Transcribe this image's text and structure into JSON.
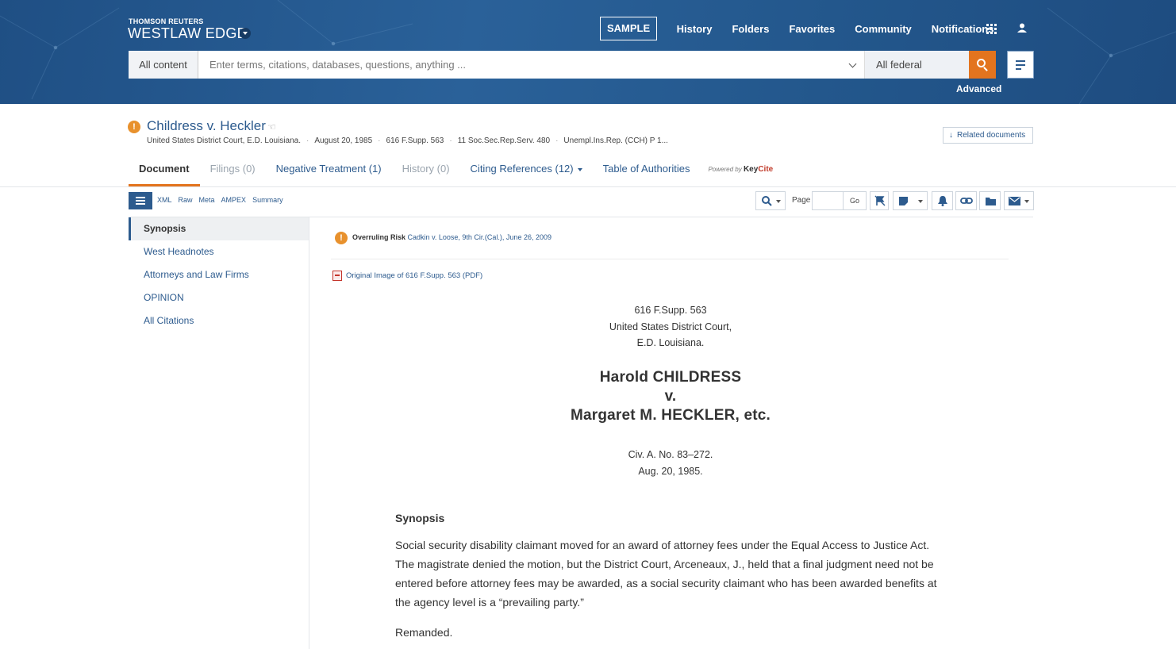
{
  "header": {
    "brand_small": "THOMSON REUTERS",
    "brand_big": "WESTLAW EDGE",
    "sample_label": "SAMPLE",
    "nav": [
      "History",
      "Folders",
      "Favorites",
      "Community",
      "Notifications"
    ],
    "advanced_label": "Advanced"
  },
  "search": {
    "scope": "All content",
    "placeholder": "Enter terms, citations, databases, questions, anything ...",
    "jurisdiction": "All federal"
  },
  "document": {
    "title": "Childress v. Heckler",
    "meta": [
      "United States District Court, E.D. Louisiana.",
      "August 20, 1985",
      "616 F.Supp. 563",
      "11 Soc.Sec.Rep.Serv. 480",
      "Unempl.Ins.Rep. (CCH) P 1..."
    ],
    "related_label": "Related documents"
  },
  "tabs": [
    {
      "label": "Document",
      "state": "active"
    },
    {
      "label": "Filings (0)",
      "state": "muted"
    },
    {
      "label": "Negative Treatment (1)",
      "state": "normal"
    },
    {
      "label": "History (0)",
      "state": "muted"
    },
    {
      "label": "Citing References (12)",
      "state": "normal"
    },
    {
      "label": "Table of Authorities",
      "state": "normal"
    }
  ],
  "keycite": {
    "powered_by": "Powered by",
    "brand_key": "Key",
    "brand_cite": "Cite"
  },
  "toolbar": {
    "formats": [
      "XML",
      "Raw",
      "Meta",
      "AMPEX",
      "Summary"
    ],
    "page_label": "Page",
    "go_label": "Go"
  },
  "toc": [
    {
      "label": "Synopsis",
      "active": true
    },
    {
      "label": "West Headnotes",
      "active": false
    },
    {
      "label": "Attorneys and Law Firms",
      "active": false
    },
    {
      "label": "OPINION",
      "active": false
    },
    {
      "label": "All Citations",
      "active": false
    }
  ],
  "risk": {
    "label": "Overruling Risk",
    "case": "Cadkin v. Loose, 9th Cir.(Cal.), June 26, 2009"
  },
  "pdf_link": "Original Image of 616 F.Supp. 563 (PDF)",
  "body": {
    "citation": "616 F.Supp. 563",
    "court_line1": "United States District Court,",
    "court_line2": "E.D. Louisiana.",
    "party1": "Harold CHILDRESS",
    "versus": "v.",
    "party2": "Margaret M. HECKLER, etc.",
    "docket": "Civ. A. No. 83–272.",
    "date": "Aug. 20, 1985.",
    "synopsis_heading": "Synopsis",
    "synopsis_text": "Social security disability claimant moved for an award of attorney fees under the Equal Access to Justice Act. The magistrate denied the motion, but the District Court, Arceneaux, J., held that a final judgment need not be entered before attorney fees may be awarded, as a social security claimant who has been awarded benefits at the agency level is a “prevailing party.”",
    "remanded": "Remanded."
  },
  "colors": {
    "brand_blue": "#2d5b8e",
    "accent_orange": "#e3741e",
    "alert_orange": "#e8912d",
    "header_bg": "#23578c"
  }
}
